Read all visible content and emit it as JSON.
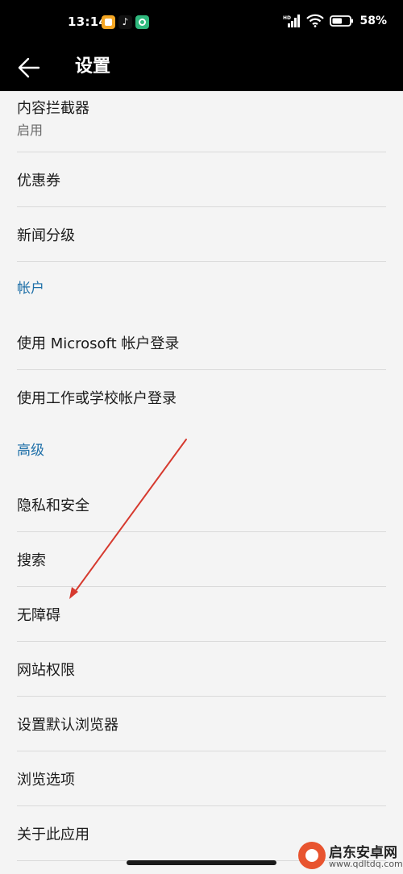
{
  "status_bar": {
    "time": "13:14",
    "network": "HD",
    "battery_percent": "58%",
    "battery_level": 0.58,
    "app_icons": [
      "notes-app-icon",
      "tiktok-app-icon",
      "settings-app-icon"
    ]
  },
  "header": {
    "title": "设置",
    "back_icon": "arrow-left-icon"
  },
  "list": {
    "content_blocker": {
      "label": "内容拦截器",
      "value": "启用"
    },
    "coupons": "优惠券",
    "news_level": "新闻分级",
    "account_section": "帐户",
    "ms_login": "使用 Microsoft 帐户登录",
    "work_login": "使用工作或学校帐户登录",
    "advanced_section": "高级",
    "privacy": "隐私和安全",
    "search": "搜索",
    "accessibility": "无障碍",
    "site_permissions": "网站权限",
    "default_browser": "设置默认浏览器",
    "browsing_options": "浏览选项",
    "about": "关于此应用"
  },
  "colors": {
    "section_header": "#1e6fa8",
    "annotation_arrow": "#d63a2f"
  },
  "watermark": {
    "name": "启东安卓网",
    "url": "www.qdltdq.com"
  }
}
